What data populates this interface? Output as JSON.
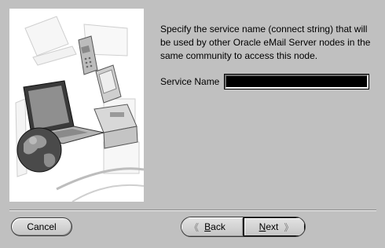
{
  "wizard": {
    "instructions": "Specify the service name (connect string) that will be used by other Oracle eMail Server nodes in the same community to access this node.",
    "service_name_label": "Service Name",
    "service_name_value": ""
  },
  "buttons": {
    "cancel": "Cancel",
    "back_key": "B",
    "back_rest": "ack",
    "next_key": "N",
    "next_rest": "ext"
  },
  "icons": {
    "back": "double-chevron-left-icon",
    "next": "double-chevron-right-icon"
  },
  "illustration": "laptop-globe-computers-illustration"
}
